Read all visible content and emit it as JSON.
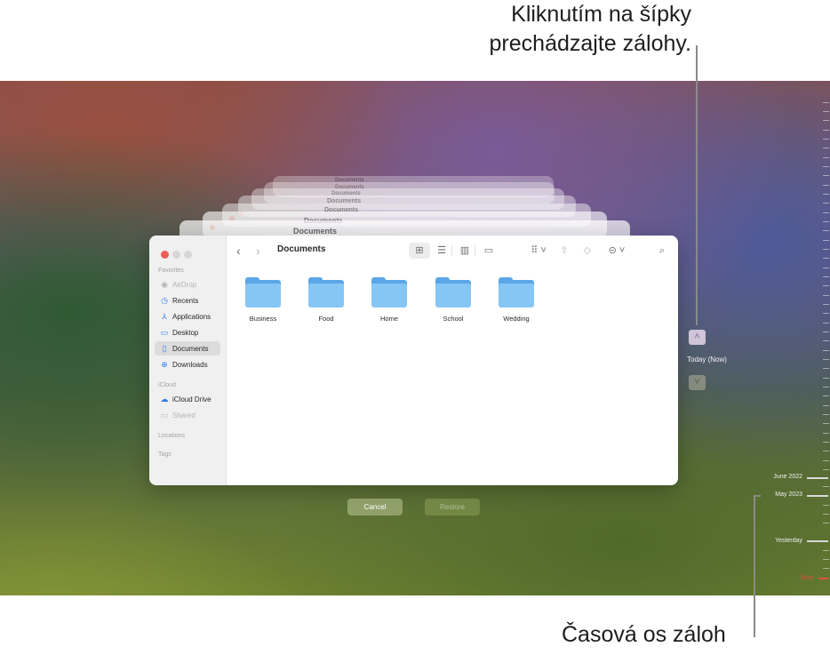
{
  "callouts": {
    "top": [
      "Kliknutím na šípky",
      "prechádzajte zálohy."
    ],
    "bottom": "Časová os záloh"
  },
  "window": {
    "path_title": "Documents",
    "traffic_lights": [
      "close",
      "minimize",
      "zoom"
    ],
    "toolbar": {
      "back_icon": "‹",
      "forward_icon": "›",
      "icon_view": "grid-icon",
      "list_view": "list-icon",
      "column_view": "columns-icon",
      "gallery_view": "gallery-icon",
      "group": "group-icon",
      "share": "share-icon",
      "tag": "tag-icon",
      "more": "ellipsis-circle-icon",
      "search": "search-icon"
    },
    "sidebar": {
      "sections": {
        "favorites": "Favorites",
        "icloud": "iCloud",
        "locations": "Locations",
        "tags": "Tags"
      },
      "favorites": [
        {
          "label": "AirDrop",
          "icon": "airdrop-icon",
          "dim": true
        },
        {
          "label": "Recents",
          "icon": "clock-icon"
        },
        {
          "label": "Applications",
          "icon": "applications-icon"
        },
        {
          "label": "Desktop",
          "icon": "desktop-icon"
        },
        {
          "label": "Documents",
          "icon": "document-icon",
          "selected": true
        },
        {
          "label": "Downloads",
          "icon": "download-icon"
        }
      ],
      "icloud": [
        {
          "label": "iCloud Drive",
          "icon": "cloud-icon"
        },
        {
          "label": "Shared",
          "icon": "shared-folder-icon",
          "dim": true
        }
      ]
    },
    "folders": [
      "Business",
      "Food",
      "Home",
      "School",
      "Wedding"
    ]
  },
  "ghost_windows": {
    "title": "Documents",
    "count": 7
  },
  "buttons": {
    "cancel": "Cancel",
    "restore": "Restore"
  },
  "navigation": {
    "up_arrow": "˄",
    "down_arrow": "˅",
    "current_label": "Today (Now)"
  },
  "timeline": {
    "labels": [
      "June 2022",
      "May 2023",
      "Yesterday",
      "Now"
    ],
    "now_color": "#e0533a"
  }
}
